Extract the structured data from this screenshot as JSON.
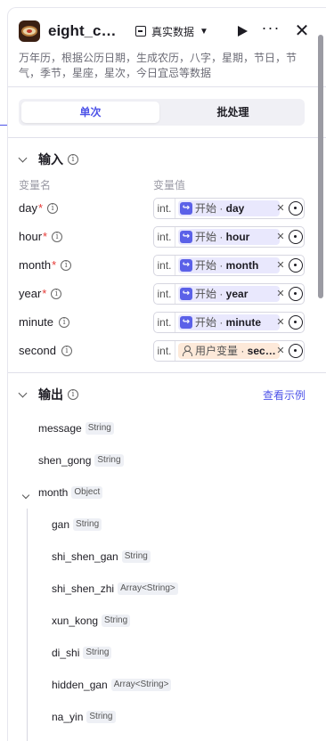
{
  "header": {
    "title": "eight_c…",
    "data_mode": "真实数据",
    "play_label": "",
    "more_label": "···",
    "close_label": "✕"
  },
  "description": "万年历，根据公历日期，生成农历，八字，星期，节日，节气，季节，星座，星次，今日宜忌等数据",
  "tabs": [
    {
      "label": "单次",
      "active": true
    },
    {
      "label": "批处理",
      "active": false
    }
  ],
  "input": {
    "title": "输入",
    "col_name": "变量名",
    "col_value": "变量值",
    "rows": [
      {
        "name": "day",
        "required": "*",
        "type": "int.",
        "ref_source": "开始 · ",
        "ref_var": "day"
      },
      {
        "name": "hour",
        "required": "*",
        "type": "int.",
        "ref_source": "开始 · ",
        "ref_var": "hour"
      },
      {
        "name": "month",
        "required": "*",
        "type": "int.",
        "ref_source": "开始 · ",
        "ref_var": "month"
      },
      {
        "name": "year",
        "required": "*",
        "type": "int.",
        "ref_source": "开始 · ",
        "ref_var": "year"
      },
      {
        "name": "minute",
        "required": "",
        "type": "int.",
        "ref_source": "开始 · ",
        "ref_var": "minute"
      },
      {
        "name": "second",
        "required": "",
        "type": "int.",
        "ref_source": "用户变量 · ",
        "ref_var": "sec…"
      }
    ]
  },
  "output": {
    "title": "输出",
    "example_link": "查看示例",
    "items": [
      {
        "name": "message",
        "type": "String"
      },
      {
        "name": "shen_gong",
        "type": "String"
      },
      {
        "name": "month",
        "type": "Object"
      },
      {
        "name": "gan",
        "type": "String"
      },
      {
        "name": "shi_shen_gan",
        "type": "String"
      },
      {
        "name": "shi_shen_zhi",
        "type": "Array<String>"
      },
      {
        "name": "xun_kong",
        "type": "String"
      },
      {
        "name": "di_shi",
        "type": "String"
      },
      {
        "name": "hidden_gan",
        "type": "Array<String>"
      },
      {
        "name": "na_yin",
        "type": "String"
      }
    ]
  },
  "colors": {
    "accent": "#4d53e8",
    "required": "#e53935",
    "ref_bg": "#e9e8fd",
    "user_ref_bg": "#fde9d9"
  }
}
